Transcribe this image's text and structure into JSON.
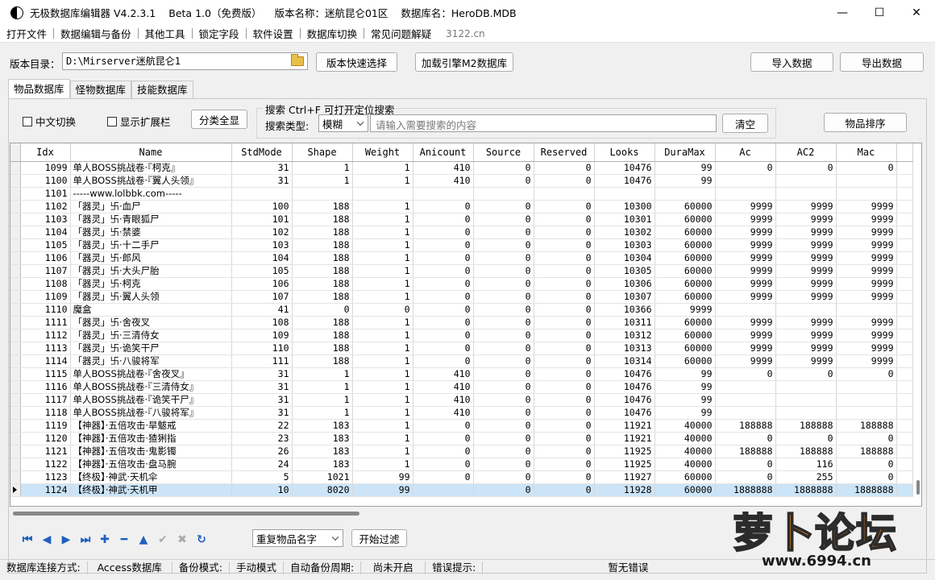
{
  "titlebar": {
    "app": "无极数据库编辑器 V4.2.3.1",
    "beta": "Beta 1.0（免费版）",
    "version_name": "版本名称：迷航昆仑01区",
    "db_name": "数据库名：HeroDB.MDB",
    "minimize": "—",
    "maximize": "☐",
    "close": "✕"
  },
  "menu": {
    "items": [
      "打开文件",
      "数据编辑与备份",
      "其他工具",
      "锁定字段",
      "软件设置",
      "数据库切换",
      "常见问题解疑"
    ],
    "link": "3122.cn"
  },
  "path": {
    "label": "版本目录：",
    "value": "D:\\Mirserver迷航昆仑1",
    "quick_select": "版本快速选择",
    "load_engine": "加载引擎M2数据库",
    "import": "导入数据",
    "export": "导出数据"
  },
  "tabs": [
    "物品数据库",
    "怪物数据库",
    "技能数据库"
  ],
  "options": {
    "chinese_toggle": "中文切换",
    "show_extension": "显示扩展栏",
    "show_all": "分类全显",
    "sort": "物品排序"
  },
  "search": {
    "title": "搜索   Ctrl+F 可打开定位搜索",
    "type_label": "搜索类型:",
    "type_value": "模糊",
    "placeholder": "请输入需要搜索的内容",
    "clear": "清空"
  },
  "grid": {
    "columns": [
      "Idx",
      "Name",
      "StdMode",
      "Shape",
      "Weight",
      "Anicount",
      "Source",
      "Reserved",
      "Looks",
      "DuraMax",
      "Ac",
      "AC2",
      "Mac"
    ],
    "selected_idx": "1124",
    "rows": [
      [
        "1099",
        "单人BOSS挑战卷·『柯克』",
        "31",
        "1",
        "1",
        "410",
        "0",
        "0",
        "10476",
        "99",
        "0",
        "0",
        "0"
      ],
      [
        "1100",
        "单人BOSS挑战卷·『翼人头领』",
        "31",
        "1",
        "1",
        "410",
        "0",
        "0",
        "10476",
        "99",
        "",
        "",
        ""
      ],
      [
        "1101",
        "-----www.lolbbk.com-----",
        "",
        "",
        "",
        "",
        "",
        "",
        "",
        "",
        "",
        "",
        ""
      ],
      [
        "1102",
        "「器灵」卐·血尸",
        "100",
        "188",
        "1",
        "0",
        "0",
        "0",
        "10300",
        "60000",
        "9999",
        "9999",
        "9999"
      ],
      [
        "1103",
        "「器灵」卐·青眼狐尸",
        "101",
        "188",
        "1",
        "0",
        "0",
        "0",
        "10301",
        "60000",
        "9999",
        "9999",
        "9999"
      ],
      [
        "1104",
        "「器灵」卐·禁婆",
        "102",
        "188",
        "1",
        "0",
        "0",
        "0",
        "10302",
        "60000",
        "9999",
        "9999",
        "9999"
      ],
      [
        "1105",
        "「器灵」卐·十二手尸",
        "103",
        "188",
        "1",
        "0",
        "0",
        "0",
        "10303",
        "60000",
        "9999",
        "9999",
        "9999"
      ],
      [
        "1106",
        "「器灵」卐·郎风",
        "104",
        "188",
        "1",
        "0",
        "0",
        "0",
        "10304",
        "60000",
        "9999",
        "9999",
        "9999"
      ],
      [
        "1107",
        "「器灵」卐·大头尸胎",
        "105",
        "188",
        "1",
        "0",
        "0",
        "0",
        "10305",
        "60000",
        "9999",
        "9999",
        "9999"
      ],
      [
        "1108",
        "「器灵」卐·柯克",
        "106",
        "188",
        "1",
        "0",
        "0",
        "0",
        "10306",
        "60000",
        "9999",
        "9999",
        "9999"
      ],
      [
        "1109",
        "「器灵」卐·翼人头领",
        "107",
        "188",
        "1",
        "0",
        "0",
        "0",
        "10307",
        "60000",
        "9999",
        "9999",
        "9999"
      ],
      [
        "1110",
        "魔盒",
        "41",
        "0",
        "0",
        "0",
        "0",
        "0",
        "10366",
        "9999",
        "",
        "",
        ""
      ],
      [
        "1111",
        "「器灵」卐·舍夜叉",
        "108",
        "188",
        "1",
        "0",
        "0",
        "0",
        "10311",
        "60000",
        "9999",
        "9999",
        "9999"
      ],
      [
        "1112",
        "「器灵」卐·三清侍女",
        "109",
        "188",
        "1",
        "0",
        "0",
        "0",
        "10312",
        "60000",
        "9999",
        "9999",
        "9999"
      ],
      [
        "1113",
        "「器灵」卐·诡笑干尸",
        "110",
        "188",
        "1",
        "0",
        "0",
        "0",
        "10313",
        "60000",
        "9999",
        "9999",
        "9999"
      ],
      [
        "1114",
        "「器灵」卐·八骏将军",
        "111",
        "188",
        "1",
        "0",
        "0",
        "0",
        "10314",
        "60000",
        "9999",
        "9999",
        "9999"
      ],
      [
        "1115",
        "单人BOSS挑战卷·『舍夜叉』",
        "31",
        "1",
        "1",
        "410",
        "0",
        "0",
        "10476",
        "99",
        "0",
        "0",
        "0"
      ],
      [
        "1116",
        "单人BOSS挑战卷·『三清侍女』",
        "31",
        "1",
        "1",
        "410",
        "0",
        "0",
        "10476",
        "99",
        "",
        "",
        ""
      ],
      [
        "1117",
        "单人BOSS挑战卷·『诡笑干尸』",
        "31",
        "1",
        "1",
        "410",
        "0",
        "0",
        "10476",
        "99",
        "",
        "",
        ""
      ],
      [
        "1118",
        "单人BOSS挑战卷·『八骏将军』",
        "31",
        "1",
        "1",
        "410",
        "0",
        "0",
        "10476",
        "99",
        "",
        "",
        ""
      ],
      [
        "1119",
        "【神器】·五倍攻击·旱魃戒",
        "22",
        "183",
        "1",
        "0",
        "0",
        "0",
        "11921",
        "40000",
        "188888",
        "188888",
        "188888"
      ],
      [
        "1120",
        "【神器】·五倍攻击·猹猁指",
        "23",
        "183",
        "1",
        "0",
        "0",
        "0",
        "11921",
        "40000",
        "0",
        "0",
        "0"
      ],
      [
        "1121",
        "【神器】·五倍攻击·鬼影镯",
        "26",
        "183",
        "1",
        "0",
        "0",
        "0",
        "11925",
        "40000",
        "188888",
        "188888",
        "188888"
      ],
      [
        "1122",
        "【神器】·五倍攻击·盘马腕",
        "24",
        "183",
        "1",
        "0",
        "0",
        "0",
        "11925",
        "40000",
        "0",
        "116",
        "0"
      ],
      [
        "1123",
        "【终极】·神武·天机伞",
        "5",
        "1021",
        "99",
        "0",
        "0",
        "0",
        "11927",
        "60000",
        "0",
        "255",
        "0"
      ],
      [
        "1124",
        "【终极】·神武·天机甲",
        "10",
        "8020",
        "99",
        "",
        "0",
        "0",
        "11928",
        "60000",
        "1888888",
        "1888888",
        "1888888"
      ]
    ]
  },
  "bottom": {
    "dedupe": "重复物品名字",
    "filter": "开始过滤"
  },
  "nav_icons": [
    "first-icon",
    "prev-icon",
    "next-icon",
    "last-icon",
    "add-icon",
    "delete-icon",
    "up-icon",
    "confirm-icon",
    "cancel-icon",
    "refresh-icon"
  ],
  "status": {
    "conn_label": "数据库连接方式:",
    "conn_value": "Access数据库",
    "backup_label": "备份模式:",
    "backup_value": "手动模式",
    "auto_label": "自动备份周期:",
    "auto_value": "尚未开启",
    "error_label": "错误提示:",
    "error_value": "暂无错误"
  },
  "watermark": {
    "brand": "萝卜论坛",
    "url": "www.6994.cn"
  },
  "colors": {
    "selected_row": "#cce4f7",
    "nav_icon": "#1f5fbf",
    "watermark": "#f58a1e"
  }
}
